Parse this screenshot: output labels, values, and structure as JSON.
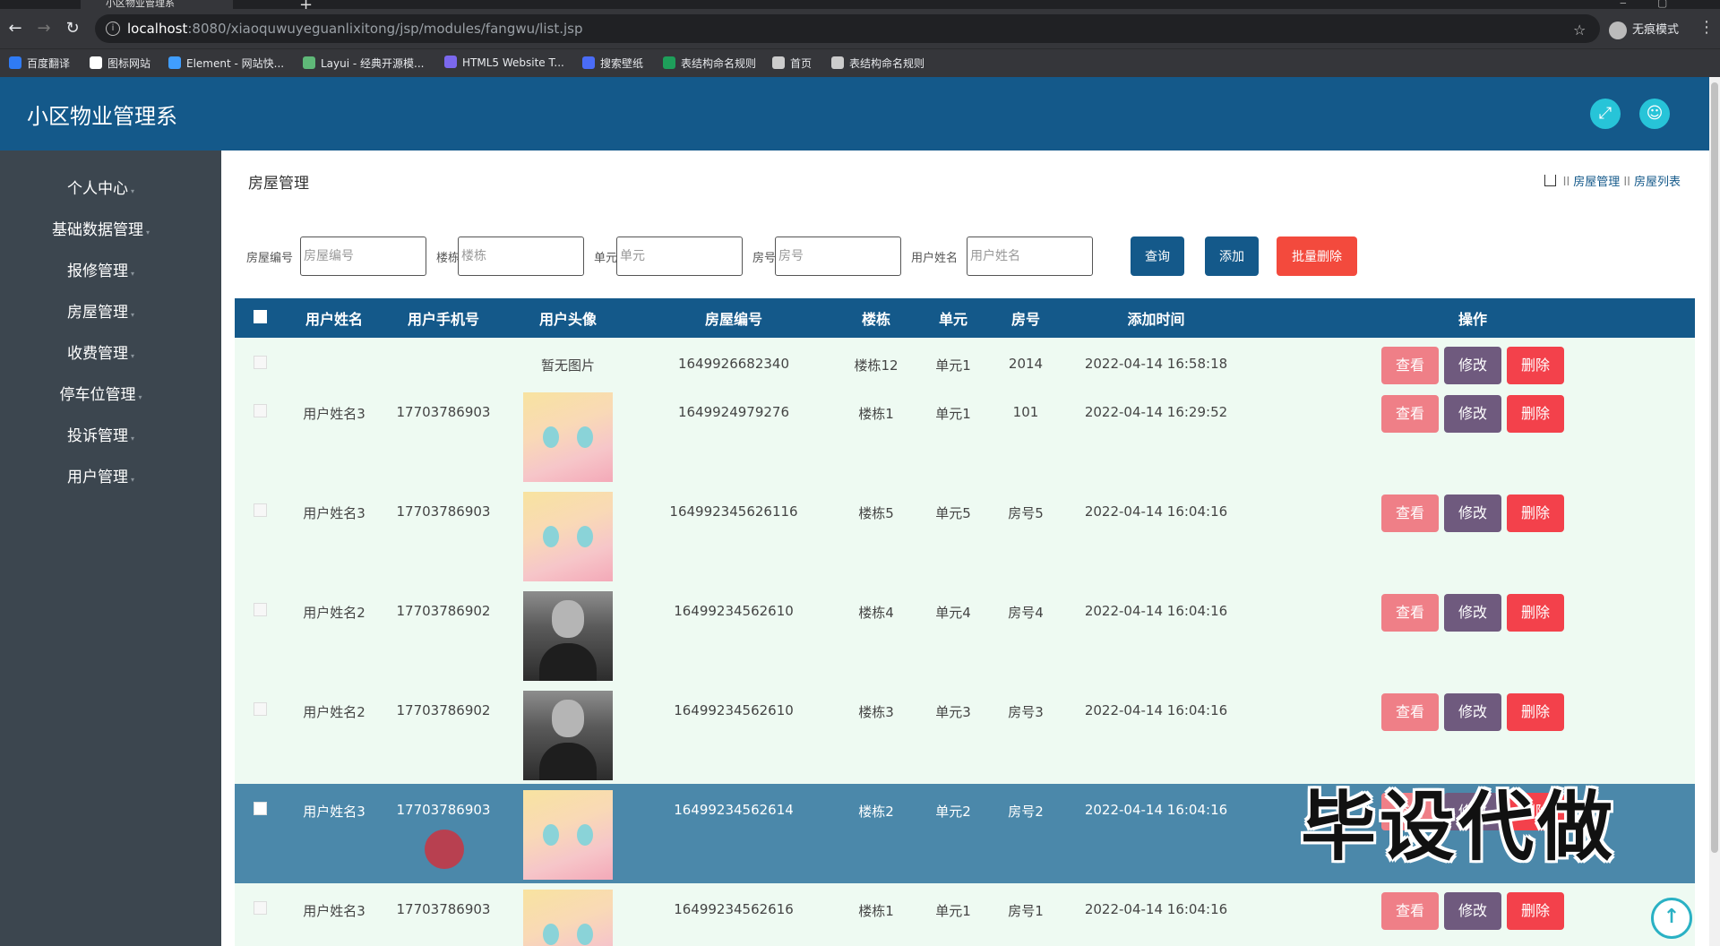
{
  "browser": {
    "tab_title": "小区物业管理系",
    "url_host": "localhost",
    "url_path": ":8080/xiaoquwuyeguanlixitong/jsp/modules/fangwu/list.jsp",
    "incognito_label": "无痕模式",
    "bookmarks": [
      {
        "label": "百度翻译",
        "color": "#2f7bf5"
      },
      {
        "label": "图标网站",
        "color": "#ffffff"
      },
      {
        "label": "Element - 网站快...",
        "color": "#409eff"
      },
      {
        "label": "Layui - 经典开源模...",
        "color": "#5fb878"
      },
      {
        "label": "HTML5 Website T...",
        "color": "#7b68ee"
      },
      {
        "label": "搜索壁纸",
        "color": "#4a6cf7"
      },
      {
        "label": "表结构命名规则",
        "color": "#1e9e5a"
      },
      {
        "label": "首页",
        "color": "#cccccc"
      },
      {
        "label": "表结构命名规则",
        "color": "#cccccc"
      }
    ]
  },
  "header": {
    "title": "小区物业管理系",
    "fullscreen_icon": "expand-icon",
    "user_icon": "user-icon",
    "accent_color": "#14598a"
  },
  "sidebar": {
    "items": [
      {
        "label": "个人中心"
      },
      {
        "label": "基础数据管理"
      },
      {
        "label": "报修管理"
      },
      {
        "label": "房屋管理"
      },
      {
        "label": "收费管理"
      },
      {
        "label": "停车位管理"
      },
      {
        "label": "投诉管理"
      },
      {
        "label": "用户管理"
      }
    ]
  },
  "main": {
    "page_title": "房屋管理",
    "breadcrumb": [
      "房屋管理",
      "房屋列表"
    ],
    "search": {
      "fields": [
        {
          "label": "房屋编号",
          "placeholder": "房屋编号"
        },
        {
          "label": "楼栋",
          "placeholder": "楼栋"
        },
        {
          "label": "单元",
          "placeholder": "单元"
        },
        {
          "label": "房号",
          "placeholder": "房号"
        },
        {
          "label": "用户姓名",
          "placeholder": "用户姓名"
        }
      ],
      "query_label": "查询",
      "add_label": "添加",
      "batch_delete_label": "批量删除"
    },
    "table": {
      "columns": [
        "用户姓名",
        "用户手机号",
        "用户头像",
        "房屋编号",
        "楼栋",
        "单元",
        "房号",
        "添加时间",
        "操作"
      ],
      "actions": {
        "view": "查看",
        "edit": "修改",
        "delete": "删除"
      },
      "rows": [
        {
          "name": "",
          "phone": "",
          "avatar": "none",
          "avatar_text": "暂无图片",
          "code": "1649926682340",
          "building": "楼栋12",
          "unit": "单元1",
          "room": "2014",
          "time": "2022-04-14 16:58:18"
        },
        {
          "name": "用户姓名3",
          "phone": "17703786903",
          "avatar": "anime",
          "avatar_text": "",
          "code": "1649924979276",
          "building": "楼栋1",
          "unit": "单元1",
          "room": "101",
          "time": "2022-04-14 16:29:52"
        },
        {
          "name": "用户姓名3",
          "phone": "17703786903",
          "avatar": "anime",
          "avatar_text": "",
          "code": "164992345626116",
          "building": "楼栋5",
          "unit": "单元5",
          "room": "房号5",
          "time": "2022-04-14 16:04:16"
        },
        {
          "name": "用户姓名2",
          "phone": "17703786902",
          "avatar": "photo",
          "avatar_text": "",
          "code": "16499234562610",
          "building": "楼栋4",
          "unit": "单元4",
          "room": "房号4",
          "time": "2022-04-14 16:04:16"
        },
        {
          "name": "用户姓名2",
          "phone": "17703786902",
          "avatar": "photo",
          "avatar_text": "",
          "code": "16499234562610",
          "building": "楼栋3",
          "unit": "单元3",
          "room": "房号3",
          "time": "2022-04-14 16:04:16"
        },
        {
          "name": "用户姓名3",
          "phone": "17703786903",
          "avatar": "anime",
          "avatar_text": "",
          "code": "16499234562614",
          "building": "楼栋2",
          "unit": "单元2",
          "room": "房号2",
          "time": "2022-04-14 16:04:16",
          "selected": true
        },
        {
          "name": "用户姓名3",
          "phone": "17703786903",
          "avatar": "anime",
          "avatar_text": "",
          "code": "16499234562616",
          "building": "楼栋1",
          "unit": "单元1",
          "room": "房号1",
          "time": "2022-04-14 16:04:16"
        }
      ]
    }
  },
  "overlay": {
    "watermark": "毕设代做",
    "back_to_top_icon": "arrow-up-icon"
  }
}
